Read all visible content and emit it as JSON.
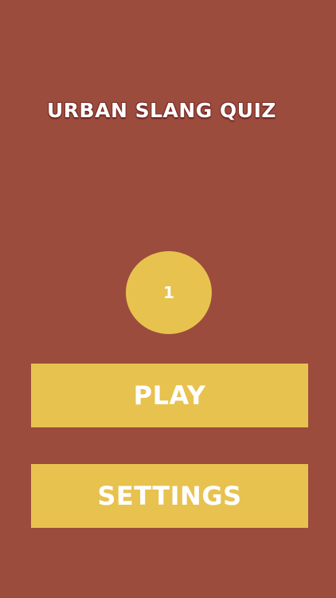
{
  "app": {
    "title": "URBAN SLANG QUIZ"
  },
  "level": {
    "value": "1"
  },
  "menu": {
    "play_label": "PLAY",
    "settings_label": "SETTINGS"
  },
  "colors": {
    "background": "#9b4c3c",
    "accent": "#e8c24f",
    "text": "#ffffff"
  }
}
